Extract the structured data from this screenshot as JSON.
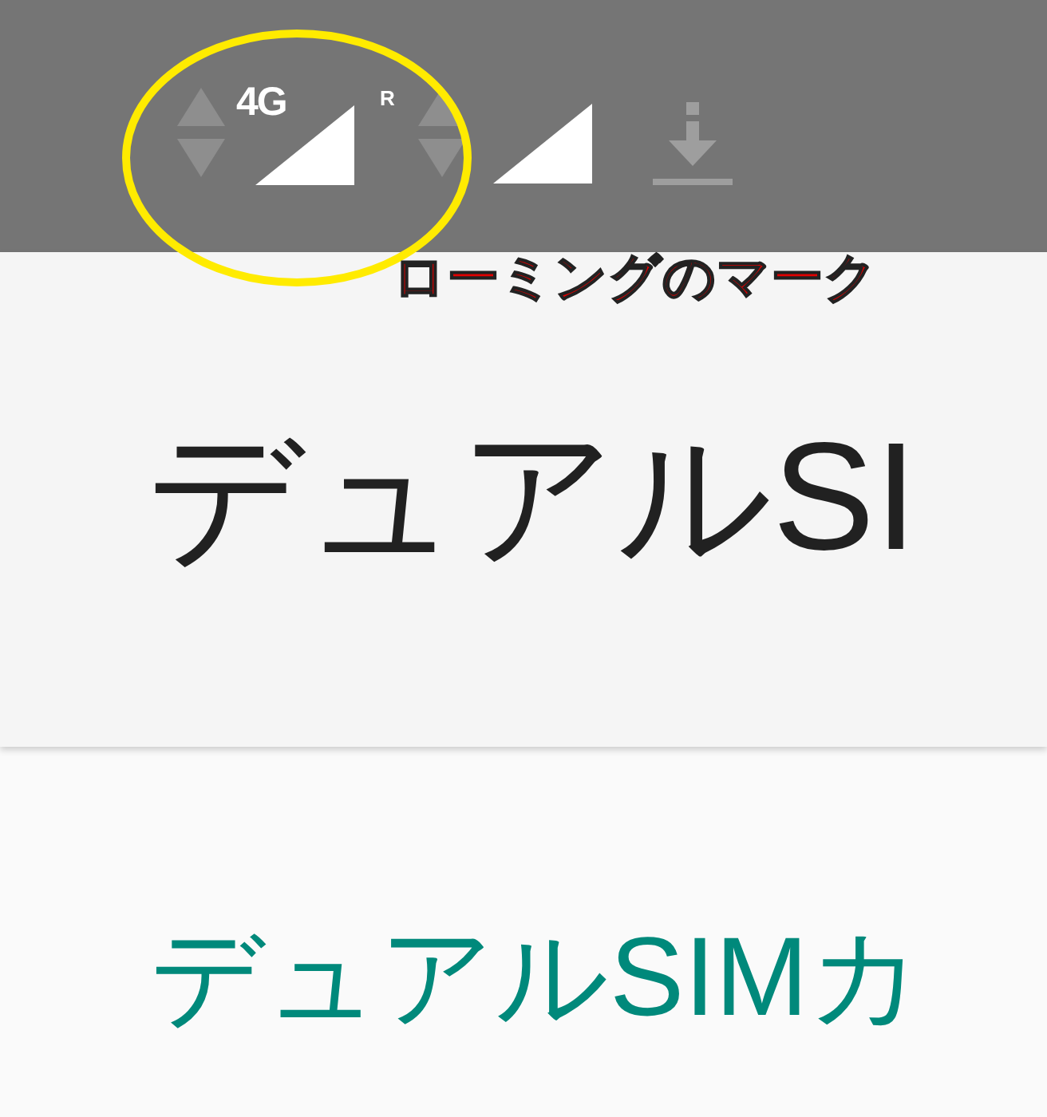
{
  "status_bar": {
    "network_type": "4G",
    "roaming_indicator": "R"
  },
  "annotation": {
    "text": "ローミングのマーク"
  },
  "toolbar": {
    "title": "デュアルSI"
  },
  "section": {
    "header": "デュアルSIMカ"
  }
}
